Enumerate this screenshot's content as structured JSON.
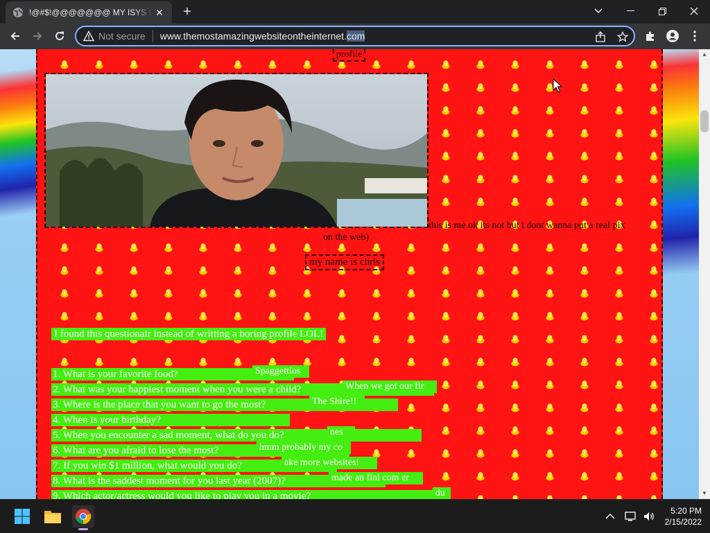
{
  "browser": {
    "tab_title": "!@#$!@@@@@@@ MY ISYS PROFILE",
    "new_tab_symbol": "+",
    "security_label": "Not secure",
    "url_main": "www.themostamazingwebsiteontheinternet.",
    "url_selected": "com"
  },
  "page": {
    "profile_label": "profile",
    "photo_caption_line1": "this is me ok its not but i dont wanna put a real pix",
    "photo_caption_line2": "on the web)",
    "name_label": "my name is chris",
    "intro": "I found this questionair instead of writting a boring profile LOL!",
    "questions": [
      {
        "q": "1.  What is your favorite food?",
        "a": "Spaggettios"
      },
      {
        "q": "2.  What was your happiest moment when you were a child?",
        "a": "When we got our fir"
      },
      {
        "q": "3.  Where is the place that you want to go the most?",
        "a": "The Shire!!"
      },
      {
        "q": "4.  When is your birthday?",
        "a": ""
      },
      {
        "q": "5.  When you encounter a sad moment, what do you do?",
        "a": "nes"
      },
      {
        "q": "6.  What are you afraid to lose the most?",
        "a": "hmm probably my co"
      },
      {
        "q": "7.  If you win $1 million, what would you do?",
        "a": "ake more websites!"
      },
      {
        "q": "8.  What is the saddest moment for you last year (2007)?",
        "a": "made an finl com er"
      },
      {
        "q": "9.  Which actor/actress would you like to play you in a movie?",
        "a": "du"
      }
    ]
  },
  "taskbar": {
    "time": "5:20 PM",
    "date": "2/15/2022"
  },
  "colors": {
    "panel_red": "#ff1414",
    "question_green": "#44ee11",
    "omnibox_focus": "#8ab4f8"
  },
  "icons": [
    "globe-favicon-icon",
    "close-tab-icon",
    "back-icon",
    "forward-icon",
    "reload-icon",
    "warning-icon",
    "share-icon",
    "star-icon",
    "extensions-icon",
    "profile-icon",
    "menu-icon",
    "windows-start-icon",
    "file-explorer-icon",
    "chrome-icon",
    "chevron-up-icon",
    "network-icon",
    "volume-icon",
    "mouse-cursor-icon"
  ]
}
